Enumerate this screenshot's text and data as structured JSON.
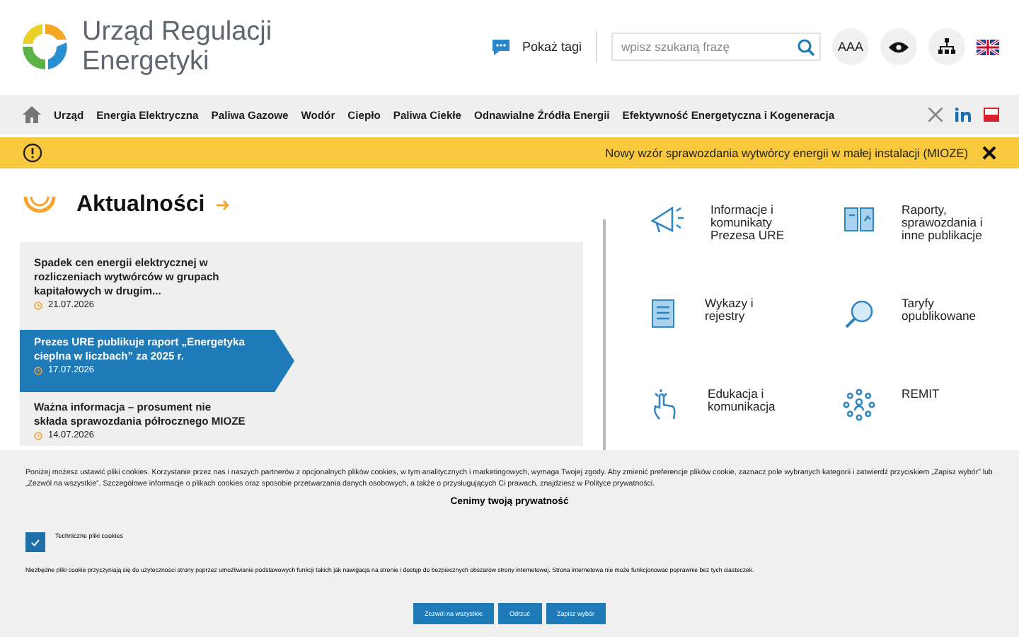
{
  "header": {
    "logo_text": "Urząd Regulacji Energetyki",
    "tags_button": "Pokaż tagi",
    "search": {
      "placeholder": "wpisz szukaną frazę"
    },
    "font_size_button": "AAA"
  },
  "nav": {
    "items": [
      "Urząd",
      "Energia Elektryczna",
      "Paliwa Gazowe",
      "Wodór",
      "Ciepło",
      "Paliwa Ciekłe",
      "Odnawialne Źródła Energii",
      "Efektywność Energetyczna i Kogeneracja"
    ]
  },
  "alert": {
    "text": "Nowy wzór sprawozdania wytwórcy energii w małej instalacji (MIOZE)"
  },
  "news": {
    "title": "Aktualności",
    "items": [
      {
        "title": "Spadek cen energii elektrycznej w rozliczeniach wytwórców w grupach kapitałowych w drugim...",
        "date": "21.07.2026",
        "selected": false
      },
      {
        "title": "Prezes URE publikuje raport „Energetyka cieplna w liczbach” za 2025 r.",
        "date": "17.07.2026",
        "selected": true
      },
      {
        "title": "Ważna informacja – prosument nie składa sprawozdania półrocznego MIOZE",
        "date": "14.07.2026",
        "selected": false
      }
    ]
  },
  "tiles": [
    "Informacje i komunikaty Prezesa URE",
    "Raporty, sprawozdania i inne publikacje",
    "Wykazy i rejestry",
    "Taryfy opublikowane",
    "Edukacja i komunikacja",
    "REMIT"
  ],
  "cookies": {
    "intro": "Poniżej możesz ustawić pliki cookies. Korzystanie przez nas i naszych partnerów z opcjonalnych plików cookies, w tym analitycznych i marketingowych, wymaga Twojej zgody. Aby zmienić preferencje plików cookie, zaznacz pole wybranych kategorii i zatwierdź przyciskiem „Zapisz wybór” lub „Zezwól na wszystkie”. Szczegółowe informacje o plikach cookies oraz sposobie przetwarzania danych osobowych, a także o przysługujących Ci prawach, znajdziesz w Polityce prywatności.",
    "title": "Cenimy twoją prywatność",
    "category": {
      "label": "Techniczne pliki cookies",
      "checked": true
    },
    "description": "Niezbędne pliki cookie przyczyniają się do użyteczności strony poprzez umożliwianie podstawowych funkcji takich jak nawigacja na stronie i dostęp do bezpiecznych obszarów strony internetowej. Strona internetowa nie może funkcjonować poprawnie bez tych ciasteczek.",
    "buttons": [
      "Zezwól na wszystkie",
      "Odrzuć",
      "Zapisz wybór"
    ]
  }
}
